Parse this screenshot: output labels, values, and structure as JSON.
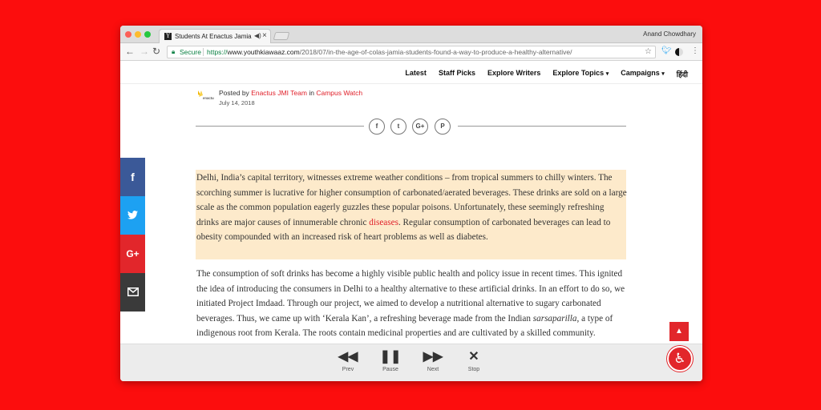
{
  "browser": {
    "tab_title": "Students At Enactus Jamia",
    "profile_name": "Anand Chowdhary",
    "secure_label": "Secure",
    "url_scheme": "https://",
    "url_host": "www.youthkiawaaz.com",
    "url_path": "/2018/07/in-the-age-of-colas-jamia-students-found-a-way-to-produce-a-healthy-alternative/",
    "favicon": "Y"
  },
  "nav": {
    "items": [
      "Latest",
      "Staff Picks",
      "Explore Writers",
      "Explore Topics",
      "Campaigns",
      "हिंदी"
    ],
    "caret": "▾"
  },
  "post": {
    "posted_by": "Posted by",
    "author": "Enactus JMI Team",
    "in_label": "in",
    "category": "Campus Watch",
    "date": "July 14, 2018",
    "logo_text": "enactus"
  },
  "share": {
    "facebook": "f",
    "twitter": "t",
    "google": "G+",
    "pinterest": "P"
  },
  "article": {
    "p1_a": "Delhi, India’s capital territory, witnesses extreme weather conditions – from tropical summers to chilly winters. The scorching summer is lucrative for higher consumption of carbonated/aerated beverages. These drinks are sold on a large scale as the common population eagerly guzzles these popular poisons. Unfortunately, these seemingly refreshing drinks are major causes of innumerable chronic ",
    "p1_link": "diseases",
    "p1_b": ". Regular consumption of carbonated beverages can lead to obesity compounded with an increased risk of heart problems as well as diabetes.",
    "p2_a": "The consumption of soft drinks has become a highly visible public health and policy issue in recent times. This ignited the idea of introducing the consumers in Delhi to a healthy alternative to these artificial drinks. In an effort to do so, we initiated Project Imdaad. Through our project, we aimed to develop a nutritional alternative to sugary carbonated beverages. Thus, we came up with ‘Kerala Kan’, a refreshing beverage made from the Indian ",
    "p2_italic": "sarsaparilla",
    "p2_b": ", a type of indigenous root from Kerala. The roots contain medicinal properties and are cultivated by a skilled community. ‘Sarasaparilla’ works like magic especially due to its cooling effects which protects one from common summer ailments and acts as a natural blood purifier."
  },
  "social": {
    "facebook": "f",
    "google": "G+"
  },
  "player": {
    "prev": "Prev",
    "pause": "Pause",
    "next": "Next",
    "stop": "Stop"
  },
  "colors": {
    "accent": "#e2262b",
    "background": "#fc0d0d",
    "highlight": "#fdeacb"
  }
}
